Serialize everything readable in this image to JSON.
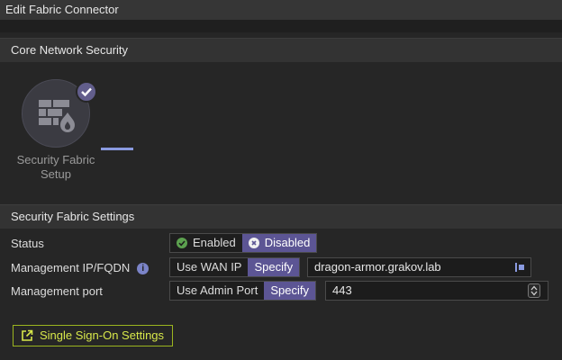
{
  "window": {
    "title": "Edit Fabric Connector"
  },
  "sections": {
    "core": "Core Network Security",
    "settings": "Security Fabric Settings"
  },
  "fabric_setup": {
    "label_line1": "Security Fabric",
    "label_line2": "Setup",
    "icon": "firewall-icon",
    "badge_icon": "check-icon"
  },
  "status": {
    "label": "Status",
    "options": [
      "Enabled",
      "Disabled"
    ],
    "selected": "Disabled"
  },
  "management_ip": {
    "label": "Management IP/FQDN",
    "options": [
      "Use WAN IP",
      "Specify"
    ],
    "selected": "Specify",
    "value": "dragon-armor.grakov.lab"
  },
  "management_port": {
    "label": "Management port",
    "options": [
      "Use Admin Port",
      "Specify"
    ],
    "selected": "Specify",
    "value": "443"
  },
  "sso_button": {
    "label": "Single Sign-On Settings",
    "icon": "external-link-icon"
  },
  "colors": {
    "accent": "#5c5594",
    "enabled_green": "#5ca14f",
    "sso_highlight": "#9bb51f"
  }
}
